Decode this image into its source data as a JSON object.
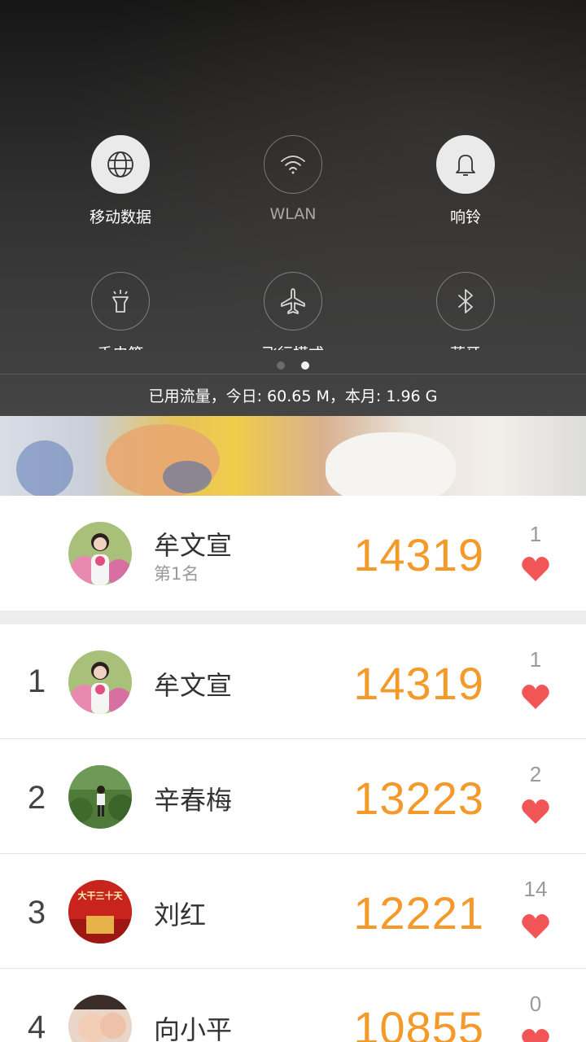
{
  "quick_settings": {
    "tiles": [
      {
        "label": "移动数据",
        "icon": "globe-icon",
        "on": true
      },
      {
        "label": "WLAN",
        "icon": "wifi-icon",
        "on": false
      },
      {
        "label": "响铃",
        "icon": "bell-icon",
        "on": true
      },
      {
        "label": "手电筒",
        "icon": "flashlight-icon",
        "on": false
      },
      {
        "label": "飞行模式",
        "icon": "airplane-icon",
        "on": false
      },
      {
        "label": "蓝牙",
        "icon": "bluetooth-icon",
        "on": false
      }
    ],
    "page_indicator": {
      "pages": 2,
      "active": 2
    },
    "traffic_text": "已用流量，今日: 60.65 M，本月: 1.96 G"
  },
  "my_entry": {
    "name": "牟文宣",
    "rank_text": "第1名",
    "score": "14319",
    "likes": "1"
  },
  "leaderboard": [
    {
      "rank": "1",
      "name": "牟文宣",
      "score": "14319",
      "likes": "1"
    },
    {
      "rank": "2",
      "name": "辛春梅",
      "score": "13223",
      "likes": "2"
    },
    {
      "rank": "3",
      "name": "刘红",
      "score": "12221",
      "likes": "14",
      "avatar_text": "大干三十天"
    },
    {
      "rank": "4",
      "name": "向小平",
      "score": "10855",
      "likes": "0"
    }
  ],
  "colors": {
    "score": "#f39a2b",
    "heart": "#f25555",
    "shade_bg": "#2a2a2a"
  }
}
